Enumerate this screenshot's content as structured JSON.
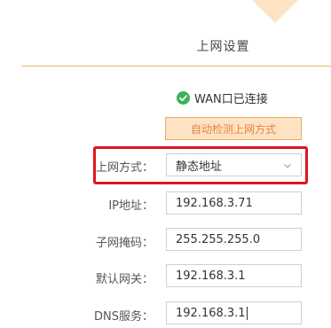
{
  "page": {
    "title": "上网设置"
  },
  "status": {
    "icon": "check-circle-icon",
    "text": "WAN口已连接",
    "color": "#3db256"
  },
  "detect_button": {
    "label": "自动检测上网方式"
  },
  "form": {
    "mode": {
      "label": "上网方式：",
      "value": "静态地址",
      "icon": "chevron-down-icon"
    },
    "ip": {
      "label": "IP地址：",
      "value": "192.168.3.71"
    },
    "mask": {
      "label": "子网掩码：",
      "value": "255.255.255.0"
    },
    "gateway": {
      "label": "默认网关：",
      "value": "192.168.3.1"
    },
    "dns": {
      "label": "DNS服务：",
      "value": "192.168.3.1"
    }
  },
  "colors": {
    "accent": "#e8833a",
    "accent_bg": "#fde3c4",
    "highlight": "#e0141e",
    "divider": "#e6b56a"
  }
}
